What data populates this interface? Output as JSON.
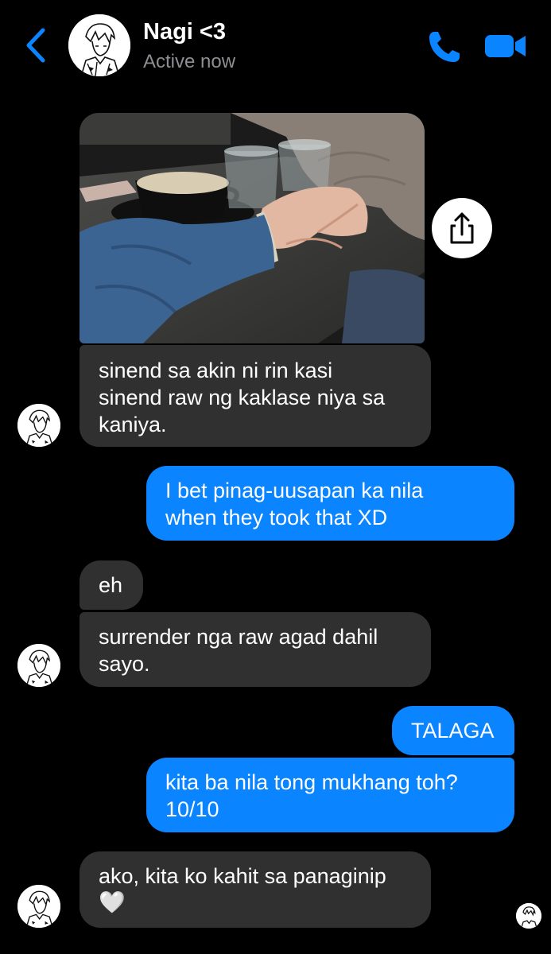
{
  "header": {
    "contact_name": "Nagi <3",
    "status": "Active now"
  },
  "colors": {
    "accent": "#0a84ff",
    "incoming_bubble": "#303030",
    "background": "#000000",
    "status_text": "#8e8e93"
  },
  "icons": {
    "back": "chevron-left-icon",
    "call": "phone-icon",
    "video": "video-camera-icon",
    "share": "share-icon",
    "heart": "white-heart-emoji"
  },
  "messages": [
    {
      "from": "contact",
      "type": "image"
    },
    {
      "from": "contact",
      "lines": [
        "sinend sa akin ni rin kasi",
        "sinend raw ng kaklase niya sa",
        "kaniya."
      ]
    },
    {
      "from": "me",
      "lines": [
        "I bet pinag-uusapan ka nila",
        "when they took that XD"
      ]
    },
    {
      "from": "contact",
      "lines": [
        "eh"
      ]
    },
    {
      "from": "contact",
      "lines": [
        "surrender nga raw agad dahil",
        "sayo."
      ]
    },
    {
      "from": "me",
      "lines": [
        "TALAGA"
      ]
    },
    {
      "from": "me",
      "lines": [
        "kita ba nila tong mukhang toh?",
        "10/10"
      ]
    },
    {
      "from": "contact",
      "lines": [
        "ako, kita ko kahit sa panaginip"
      ],
      "emoji": "🤍"
    }
  ]
}
